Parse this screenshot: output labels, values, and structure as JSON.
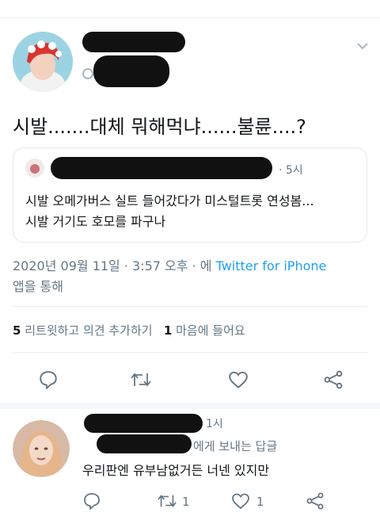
{
  "tweet": {
    "text": "시발.......대체 뭐해먹냐......불륜....?",
    "timestamp": "2020년 09월 11일 · 3:57 오후 · 에",
    "via_client": "Twitter for iPhone",
    "via_suffix": "앱을 통해",
    "quote": {
      "time": "· 5시",
      "text_line1": "시발 오메가버스 실트 들어갔다가 미스털트롯 연성봄...",
      "text_line2": "시발 거기도 호모를 파구나"
    },
    "stats": {
      "retweets_count": "5",
      "retweets_label": "리트윗하고 의견 추가하기",
      "likes_count": "1",
      "likes_label": "마음에 들어요"
    }
  },
  "reply": {
    "time": "1시",
    "replying_to_suffix": "에게 보내는 답글",
    "text": "우리판엔 유부남없거든 너넨 있지만",
    "retweet_count": "1",
    "like_count": "1"
  },
  "icons": [
    "chevron-down-icon",
    "comment-icon",
    "retweet-icon",
    "heart-icon",
    "share-icon"
  ],
  "colors": {
    "accent": "#1da1f2",
    "muted": "#657786",
    "text": "#14171a",
    "divider": "#e6ecf0"
  }
}
